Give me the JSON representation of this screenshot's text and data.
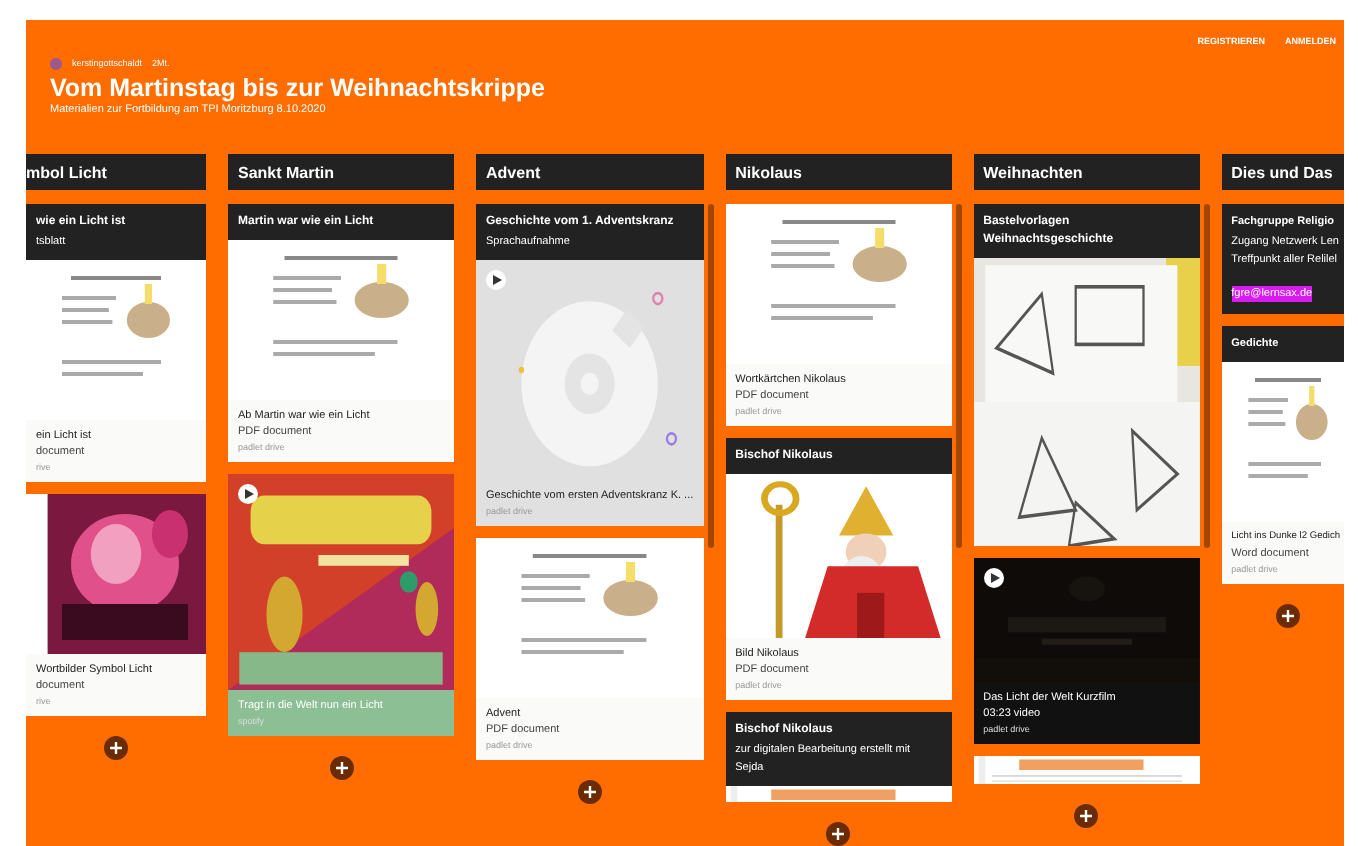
{
  "top_links": [
    "REGISTRIEREN",
    "ANMELDEN"
  ],
  "header": {
    "author": "kerstingottschaldt",
    "time": "2Mt.",
    "title": "Vom Martinstag bis zur Weihnachtskrippe",
    "subtitle": "Materialien zur Fortbildung am TPI Moritzburg 8.10.2020"
  },
  "columns": [
    {
      "title": "mbol Licht",
      "scrollbar": false,
      "cards": [
        {
          "title": "wie ein Licht ist",
          "body": "tsblatt",
          "preview": {
            "kind": "document"
          },
          "caption": {
            "title": "ein Licht ist",
            "type": "document",
            "source": "rive"
          },
          "kind": "light"
        },
        {
          "caption": {
            "title": "Wortbilder Symbol Licht",
            "type": "document",
            "source": "rive"
          },
          "kind": "light"
        }
      ]
    },
    {
      "title": "Sankt Martin",
      "scrollbar": false,
      "cards": [
        {
          "title": "Martin war wie ein Licht",
          "preview": {
            "kind": "document"
          },
          "caption": {
            "title": "Ab Martin war wie ein Licht",
            "type": "PDF document",
            "source": "padlet drive"
          },
          "kind": "light"
        },
        {
          "preview": {
            "kind": "cover",
            "play": true
          },
          "caption": {
            "title": "Tragt in die Welt nun ein Licht",
            "source": "spotify"
          },
          "kind": "green"
        }
      ]
    },
    {
      "title": "Advent",
      "scrollbar": true,
      "cards": [
        {
          "title": "Geschichte vom 1. Adventskranz",
          "body": "Sprachaufnahme",
          "preview": {
            "kind": "audio",
            "play": true
          },
          "caption": {
            "title": "Geschichte vom ersten Adventskranz K. ...",
            "source": "padlet drive"
          },
          "kind": "grey"
        },
        {
          "preview": {
            "kind": "document"
          },
          "caption": {
            "title": "Advent",
            "type": "PDF document",
            "source": "padlet drive"
          },
          "kind": "light"
        }
      ]
    },
    {
      "title": "Nikolaus",
      "scrollbar": true,
      "cards": [
        {
          "preview": {
            "kind": "document"
          },
          "caption": {
            "title": "Wortkärtchen Nikolaus",
            "type": "PDF document",
            "source": "padlet drive"
          },
          "kind": "light"
        },
        {
          "title": "Bischof Nikolaus",
          "preview": {
            "kind": "illustration"
          },
          "caption": {
            "title": "Bild Nikolaus",
            "type": "PDF document",
            "source": "padlet drive"
          },
          "kind": "light"
        },
        {
          "title": "Bischof Nikolaus",
          "body": "zur digitalen Bearbeitung erstellt mit Sejda",
          "preview": {
            "kind": "strip"
          },
          "kind": "light"
        }
      ]
    },
    {
      "title": "Weihnachten",
      "scrollbar": true,
      "cards": [
        {
          "title": "Bastelvorlagen Weihnachtsgeschichte",
          "preview": {
            "kind": "sketch"
          },
          "kind": "light"
        },
        {
          "preview": {
            "kind": "video",
            "play": true
          },
          "caption": {
            "title": "Das Licht der Welt Kurzfilm",
            "type": "03:23 video",
            "source": "padlet drive"
          },
          "kind": "dark"
        },
        {
          "preview": {
            "kind": "strip"
          },
          "kind": "light"
        }
      ]
    },
    {
      "title": "Dies und Das",
      "scrollbar": false,
      "cards": [
        {
          "title": "Fachgruppe Religio",
          "body": "Zugang Netzwerk Len",
          "body2": "Treffpunkt aller Relilel",
          "link": "fgre@lernsax.de",
          "kind": "light"
        },
        {
          "title": "Gedichte",
          "preview": {
            "kind": "document"
          },
          "caption": {
            "title": "Licht ins Dunke l2 Gedich",
            "type": "Word document",
            "source": "padlet drive"
          },
          "kind": "light"
        }
      ]
    }
  ]
}
